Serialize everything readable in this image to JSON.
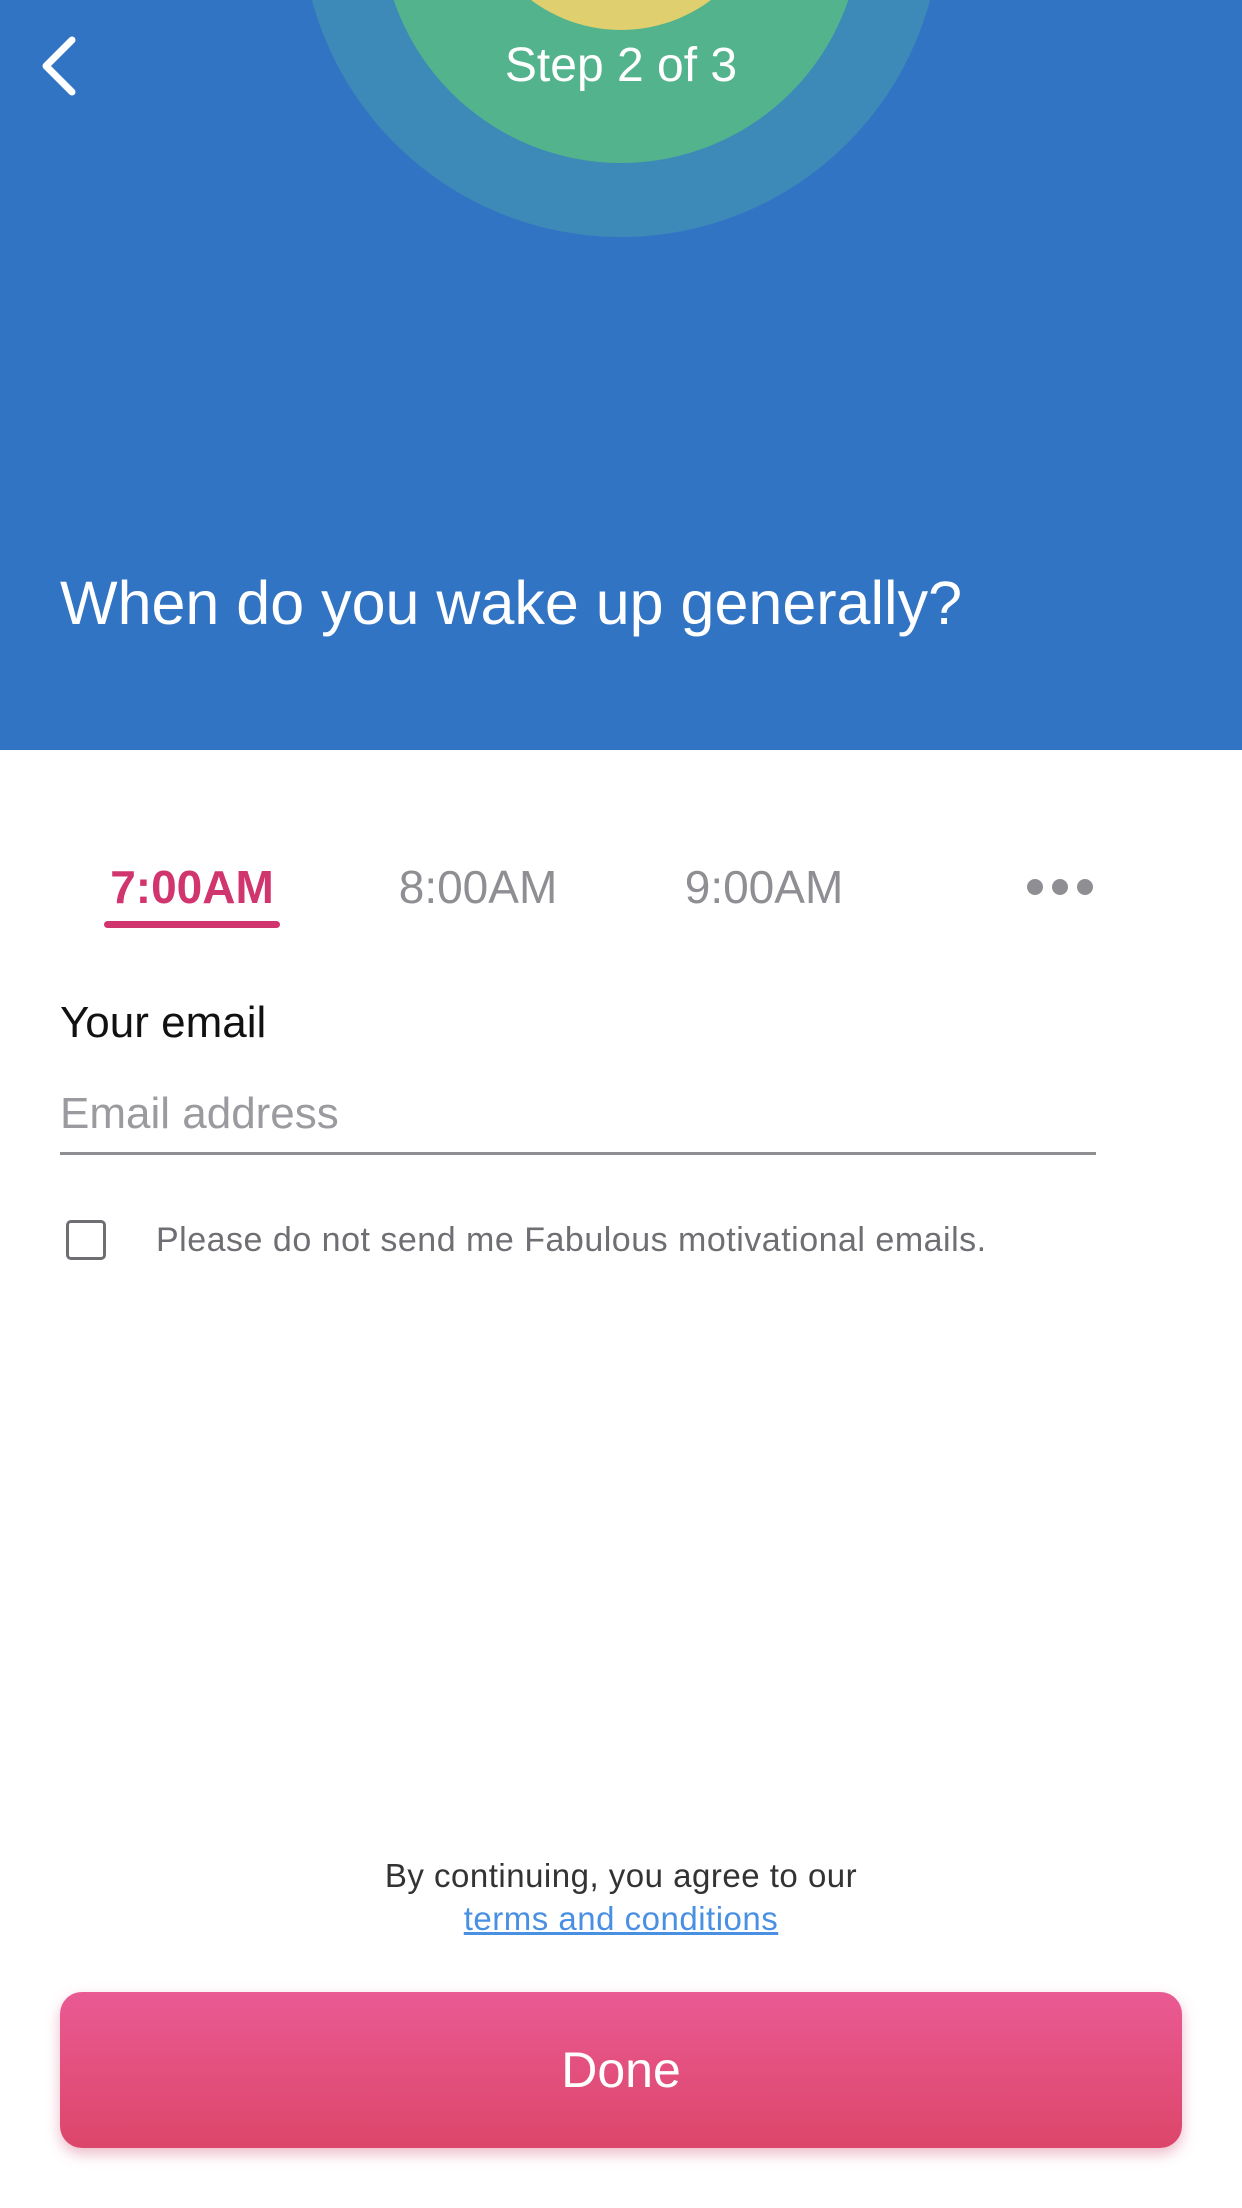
{
  "header": {
    "step": "Step 2 of 3",
    "question": "When do you wake up generally?",
    "back_icon": "chevron-left-icon",
    "background_color": "#3274c4"
  },
  "time_options": {
    "options": [
      "7:00AM",
      "8:00AM",
      "9:00AM"
    ],
    "selected": "7:00AM",
    "more_icon": "more-horizontal-icon",
    "accent_color": "#d0356d"
  },
  "email": {
    "label": "Your email",
    "placeholder": "Email address",
    "value": ""
  },
  "optout": {
    "checked": false,
    "label": "Please do not send me Fabulous motivational emails."
  },
  "terms": {
    "text": "By continuing, you agree to our",
    "link": "terms and conditions"
  },
  "done_button": {
    "label": "Done"
  }
}
